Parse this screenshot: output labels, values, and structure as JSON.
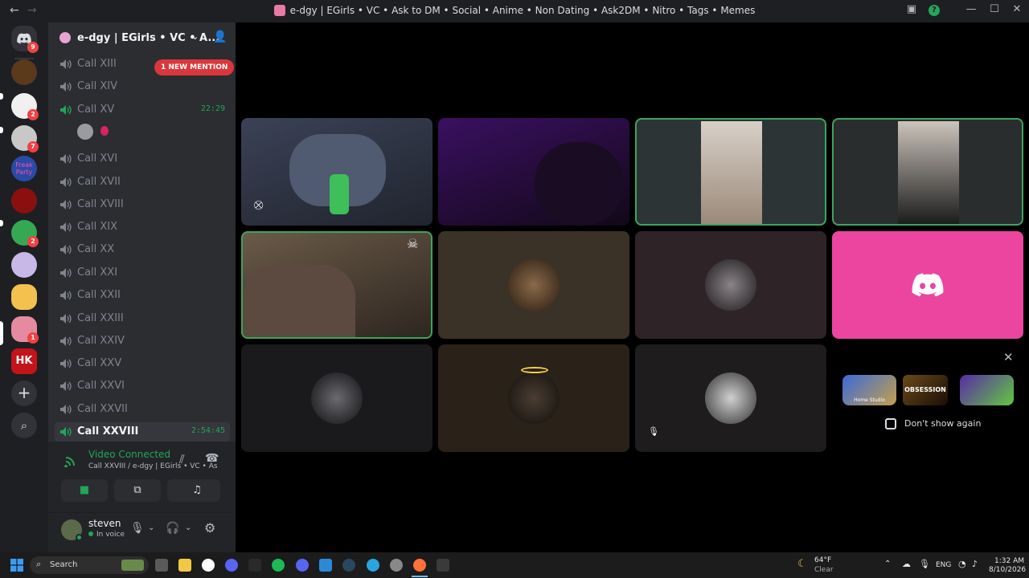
{
  "window": {
    "title": "e-dgy | EGirls • VC • Ask to DM • Social • Anime • Non Dating • Ask2DM • Nitro • Tags • Memes",
    "back": "←",
    "forward": "→",
    "minimize": "—",
    "maximize": "☐",
    "close": "✕"
  },
  "server_rail": {
    "items": [
      {
        "name": "discord-home",
        "badge": "9",
        "color": "#313338"
      },
      {
        "name": "server-1",
        "badge": "",
        "color": "#5a3a1a"
      },
      {
        "name": "server-2",
        "badge": "2",
        "color": "#ffffff"
      },
      {
        "name": "server-3",
        "badge": "7",
        "color": "#d0d0d0"
      },
      {
        "name": "server-freak-party",
        "label": "Freak Party",
        "badge": "",
        "color": "#2a4aa8"
      },
      {
        "name": "server-5",
        "badge": "",
        "color": "#8a1010"
      },
      {
        "name": "server-6",
        "badge": "2",
        "color": "#34a853"
      },
      {
        "name": "server-7",
        "badge": "",
        "color": "#c8b8e8"
      },
      {
        "name": "server-8",
        "badge": "",
        "color": "#f2c14e"
      },
      {
        "name": "server-9",
        "badge": "1",
        "color": "#e58aa0"
      },
      {
        "name": "server-hk",
        "label": "HK",
        "badge": "",
        "color": "#c4141b"
      }
    ],
    "add_server": "+",
    "discover": "⌕"
  },
  "sidebar": {
    "server_name": "e-dgy | EGirls • VC • A...",
    "new_mention": "1 NEW MENTION",
    "channels": [
      {
        "name": "Call XIII",
        "time": "",
        "active": false
      },
      {
        "name": "Call XIV",
        "time": "",
        "active": false
      },
      {
        "name": "Call XV",
        "time": "22:29",
        "active": false
      },
      {
        "name": "Call XVI",
        "time": "",
        "active": false
      },
      {
        "name": "Call XVII",
        "time": "",
        "active": false
      },
      {
        "name": "Call XVIII",
        "time": "",
        "active": false
      },
      {
        "name": "Call XIX",
        "time": "",
        "active": false
      },
      {
        "name": "Call XX",
        "time": "",
        "active": false
      },
      {
        "name": "Call XXI",
        "time": "",
        "active": false
      },
      {
        "name": "Call XXII",
        "time": "",
        "active": false
      },
      {
        "name": "Call XXIII",
        "time": "",
        "active": false
      },
      {
        "name": "Call XXIV",
        "time": "",
        "active": false
      },
      {
        "name": "Call XXV",
        "time": "",
        "active": false
      },
      {
        "name": "Call XXVI",
        "time": "",
        "active": false
      },
      {
        "name": "Call XXVII",
        "time": "",
        "active": false
      },
      {
        "name": "Call XXVIII",
        "time": "2:54:45",
        "active": true
      }
    ]
  },
  "voice": {
    "status": "Video Connected",
    "location": "Call XXVIII / e-dgy | EGirls • VC • As...",
    "status_color": "#23a55a"
  },
  "user": {
    "name": "steven",
    "status": "In voice"
  },
  "stage": {
    "tiles": [
      {
        "kind": "video",
        "color": "#2b3140",
        "speaking": false
      },
      {
        "kind": "video",
        "color": "#28143a",
        "speaking": false
      },
      {
        "kind": "video",
        "color": "#2d3436",
        "speaking": true
      },
      {
        "kind": "video",
        "color": "#2a2d2e",
        "speaking": true
      },
      {
        "kind": "video",
        "color": "#4a3b30",
        "speaking": true
      },
      {
        "kind": "avatar",
        "color": "#3a3226",
        "speaking": false
      },
      {
        "kind": "avatar",
        "color": "#2e2428",
        "speaking": false
      },
      {
        "kind": "discord-logo",
        "color": "#eb459f",
        "speaking": false
      },
      {
        "kind": "avatar",
        "color": "#1a1a1c",
        "speaking": false
      },
      {
        "kind": "avatar",
        "color": "#2a2118",
        "speaking": false
      },
      {
        "kind": "avatar",
        "color": "#1e1c1c",
        "speaking": false
      }
    ],
    "promo": {
      "close": "✕",
      "cards": [
        "Home Studio",
        "OBSESSION",
        ""
      ],
      "dont_show": "Don't show again"
    }
  },
  "taskbar": {
    "search": "Search",
    "weather_temp": "64°F",
    "weather_desc": "Clear",
    "lang": "ENG",
    "time": "1:32 AM",
    "date": "8/10/2026"
  }
}
